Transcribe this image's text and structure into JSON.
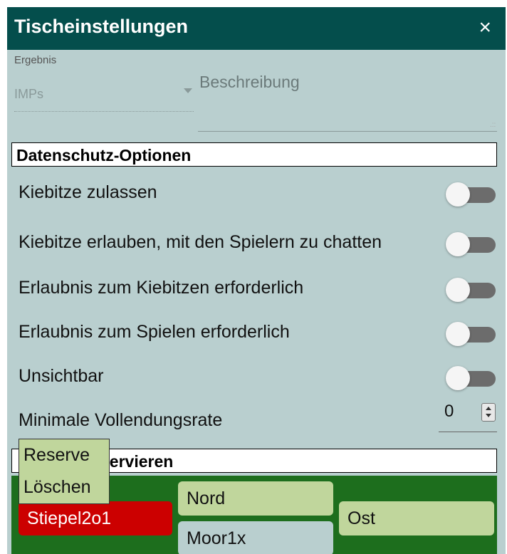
{
  "dialog": {
    "title": "Tischeinstellungen",
    "close_glyph": "×"
  },
  "scoring": {
    "label": "Ergebnis",
    "value": "IMPs"
  },
  "description": {
    "label": "Beschreibung",
    "value": ""
  },
  "privacy": {
    "header": "Datenschutz-Optionen",
    "options": [
      {
        "label": "Kiebitze zulassen",
        "on": false
      },
      {
        "label": "Kiebitze erlauben, mit den Spielern zu chatten",
        "on": false
      },
      {
        "label": "Erlaubnis zum Kiebitzen erforderlich",
        "on": false
      },
      {
        "label": "Erlaubnis zum Spielen erforderlich",
        "on": false
      },
      {
        "label": "Unsichtbar",
        "on": false
      }
    ],
    "min_completion": {
      "label": "Minimale Vollendungsrate",
      "value": "0"
    }
  },
  "reserve": {
    "header_visible": "servieren"
  },
  "context_menu": {
    "items": [
      "Reserve",
      "Löschen"
    ]
  },
  "seats": {
    "south": "Stiepel2o1",
    "north": "Nord",
    "east": "Ost",
    "west": "Moor1x"
  },
  "colors": {
    "title_bar": "#044e4c",
    "panel_bg": "#b9cfcf",
    "table_green": "#1d6e1d",
    "seat_red": "#cc0000",
    "seat_light": "#c0d69c"
  }
}
